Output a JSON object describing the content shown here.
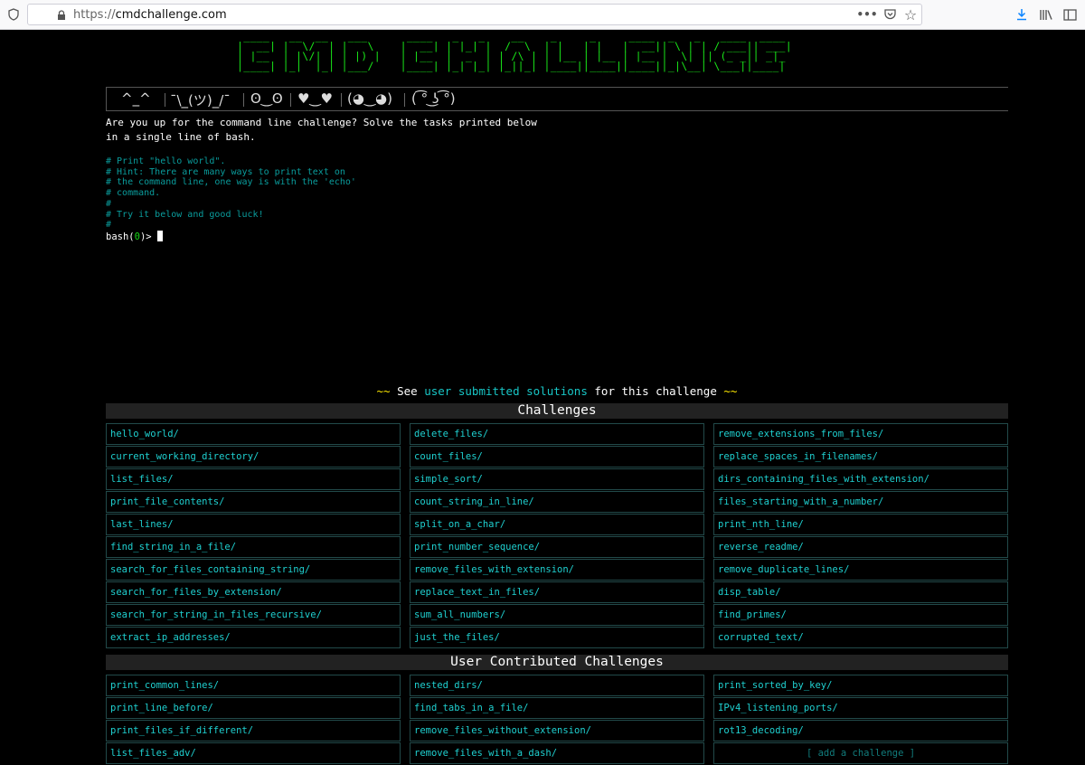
{
  "browser": {
    "url_scheme": "https://",
    "url_host": "cmdchallenge.com",
    "icons": [
      "shield-icon",
      "lock-icon",
      "more-icon",
      "pocket-icon",
      "star-icon",
      "download-icon",
      "library-icon",
      "sidebar-icon"
    ]
  },
  "header": {
    "logo_text": "cmd challenge"
  },
  "emotes": [
    "^_^",
    "¯\\_(ツ)_/¯",
    "ʘ‿ʘ",
    "♥‿♥",
    "(◕‿◕)",
    "( ͡° ͜ʖ ͡°)"
  ],
  "intro": {
    "text": "Are you up for the command line challenge? Solve the tasks printed below in a single line of bash."
  },
  "task_comment": "# Print \"hello world\".\n# Hint: There are many ways to print text on\n# the command line, one way is with the 'echo'\n# command.\n#\n# Try it below and good luck!\n#",
  "prompt": {
    "prefix": "bash(",
    "status": "0",
    "suffix": ")> "
  },
  "solutions_line": {
    "tilde_left": "~~",
    "see": "See",
    "link": "user submitted solutions",
    "rest": "for this challenge",
    "tilde_right": "~~"
  },
  "challenges": {
    "title": "Challenges",
    "items": [
      "hello_world/",
      "delete_files/",
      "remove_extensions_from_files/",
      "current_working_directory/",
      "count_files/",
      "replace_spaces_in_filenames/",
      "list_files/",
      "simple_sort/",
      "dirs_containing_files_with_extension/",
      "print_file_contents/",
      "count_string_in_line/",
      "files_starting_with_a_number/",
      "last_lines/",
      "split_on_a_char/",
      "print_nth_line/",
      "find_string_in_a_file/",
      "print_number_sequence/",
      "reverse_readme/",
      "search_for_files_containing_string/",
      "remove_files_with_extension/",
      "remove_duplicate_lines/",
      "search_for_files_by_extension/",
      "replace_text_in_files/",
      "disp_table/",
      "search_for_string_in_files_recursive/",
      "sum_all_numbers/",
      "find_primes/",
      "extract_ip_addresses/",
      "just_the_files/",
      "corrupted_text/"
    ]
  },
  "user_challenges": {
    "title": "User Contributed Challenges",
    "items": [
      "print_common_lines/",
      "nested_dirs/",
      "print_sorted_by_key/",
      "print_line_before/",
      "find_tabs_in_a_file/",
      "IPv4_listening_ports/",
      "print_files_if_different/",
      "remove_files_without_extension/",
      "rot13_decoding/",
      "list_files_adv/",
      "remove_files_with_a_dash/"
    ],
    "add_label": "[ add a challenge ]"
  }
}
